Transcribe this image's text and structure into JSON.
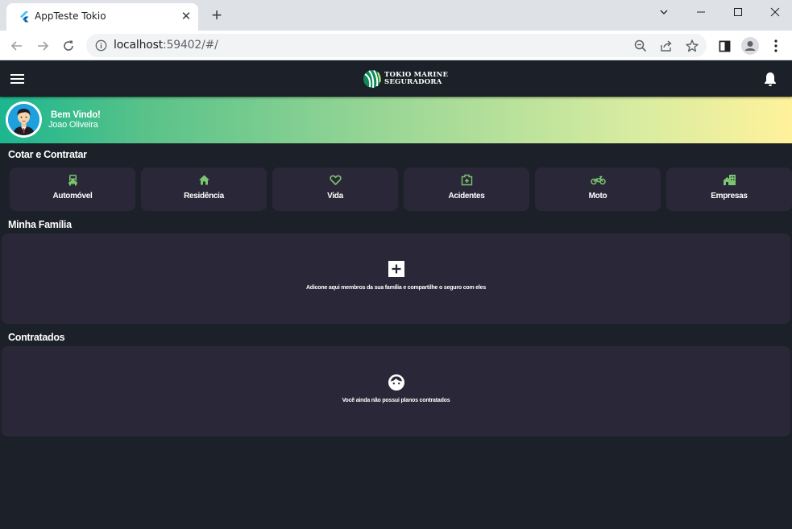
{
  "browser": {
    "tab_title": "AppTeste Tokio",
    "url_host": "localhost",
    "url_rest": ":59402/#/"
  },
  "app": {
    "logo_line1": "TOKIO MARINE",
    "logo_line2": "SEGURADORA",
    "banner": {
      "welcome": "Bem Vindo!",
      "user_name": "Joao Oliveira"
    },
    "quote_section_title": "Cotar e Contratar",
    "products": [
      {
        "label": "Automóvel",
        "icon": "car-icon"
      },
      {
        "label": "Residência",
        "icon": "home-icon"
      },
      {
        "label": "Vida",
        "icon": "heart-icon"
      },
      {
        "label": "Acidentes",
        "icon": "medical-kit-icon"
      },
      {
        "label": "Moto",
        "icon": "motorcycle-icon"
      },
      {
        "label": "Empresas",
        "icon": "buildings-icon"
      }
    ],
    "family_section_title": "Minha Família",
    "family_message": "Adicone aqui membros da sua família e compartilhe o seguro com eles",
    "contracted_section_title": "Contratados",
    "contracted_message": "Você ainda não possui planos contratados",
    "colors": {
      "background": "#1c2028",
      "card": "#2a2838",
      "icon_green": "#7cc46f",
      "banner_start": "#1cb68f",
      "banner_end": "#fff29b"
    }
  }
}
